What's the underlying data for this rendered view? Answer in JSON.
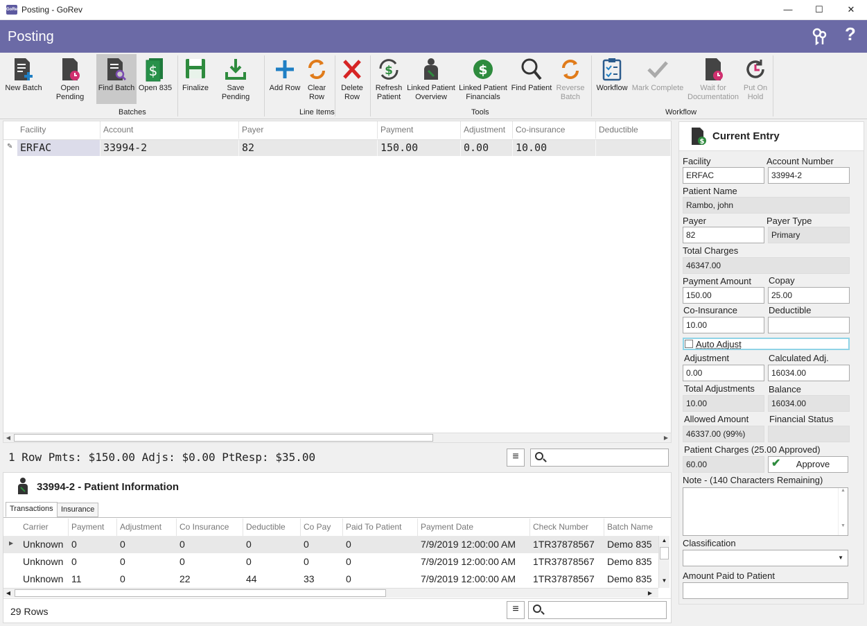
{
  "window": {
    "title": "Posting - GoRev",
    "min": "—",
    "max": "☐",
    "close": "✕",
    "app_icon": "GoRev"
  },
  "header": {
    "title": "Posting",
    "keys_icon": "keys-icon",
    "help": "?"
  },
  "ribbon": {
    "buttons": {
      "new_batch": "New Batch",
      "open_pending": "Open Pending",
      "find_batch": "Find Batch",
      "open_835": "Open 835",
      "finalize": "Finalize",
      "save_pending": "Save Pending",
      "add_row": "Add Row",
      "clear_row_1": "Clear",
      "clear_row_2": "Row",
      "delete_row_1": "Delete",
      "delete_row_2": "Row",
      "refresh_patient_1": "Refresh",
      "refresh_patient_2": "Patient",
      "linked_overview_1": "Linked Patient",
      "linked_overview_2": "Overview",
      "linked_financials_1": "Linked Patient",
      "linked_financials_2": "Financials",
      "find_patient": "Find Patient",
      "reverse_batch_1": "Reverse",
      "reverse_batch_2": "Batch",
      "workflow": "Workflow",
      "mark_complete": "Mark Complete",
      "wait_doc_1": "Wait for",
      "wait_doc_2": "Documentation",
      "put_on_hold_1": "Put On",
      "put_on_hold_2": "Hold"
    },
    "groups": {
      "batches": "Batches",
      "line_items": "Line Items",
      "tools": "Tools",
      "workflow": "Workflow"
    }
  },
  "grid": {
    "headers": {
      "facility": "Facility",
      "account": "Account",
      "payer": "Payer",
      "payment": "Payment",
      "adjustment": "Adjustment",
      "coins": "Co-insurance",
      "deductible": "Deductible"
    },
    "row": {
      "facility": "ERFAC",
      "account": "33994-2",
      "payer": "82",
      "payment": "150.00",
      "adjustment": "0.00",
      "coins": "10.00",
      "deductible": ""
    },
    "summary": "1 Row Pmts: $150.00 Adjs: $0.00 PtResp: $35.00"
  },
  "patient": {
    "title": "33994-2 - Patient Information",
    "tabs": {
      "transactions": "Transactions",
      "insurance": "Insurance"
    },
    "headers": {
      "carrier": "Carrier",
      "payment": "Payment",
      "adjustment": "Adjustment",
      "coins": "Co Insurance",
      "deductible": "Deductible",
      "copay": "Co Pay",
      "paid": "Paid To Patient",
      "date": "Payment Date",
      "check": "Check Number",
      "batch": "Batch Name"
    },
    "rows": [
      {
        "carrier": "Unknown",
        "payment": "0",
        "adjustment": "0",
        "coins": "0",
        "deductible": "0",
        "copay": "0",
        "paid": "0",
        "date": "7/9/2019 12:00:00 AM",
        "check": "1TR37878567",
        "batch": "Demo 835"
      },
      {
        "carrier": "Unknown",
        "payment": "0",
        "adjustment": "0",
        "coins": "0",
        "deductible": "0",
        "copay": "0",
        "paid": "0",
        "date": "7/9/2019 12:00:00 AM",
        "check": "1TR37878567",
        "batch": "Demo 835"
      },
      {
        "carrier": "Unknown",
        "payment": "11",
        "adjustment": "0",
        "coins": "22",
        "deductible": "44",
        "copay": "33",
        "paid": "0",
        "date": "7/9/2019 12:00:00 AM",
        "check": "1TR37878567",
        "batch": "Demo 835"
      }
    ],
    "row_count": "29 Rows"
  },
  "entry": {
    "title": "Current Entry",
    "labels": {
      "facility": "Facility",
      "account_number": "Account Number",
      "patient_name": "Patient Name",
      "payer": "Payer",
      "payer_type": "Payer Type",
      "total_charges": "Total Charges",
      "payment_amount": "Payment Amount",
      "copay": "Copay",
      "coins": "Co-Insurance",
      "deductible": "Deductible",
      "auto_adjust": "Auto Adjust",
      "adjustment": "Adjustment",
      "calc_adj": "Calculated Adj.",
      "total_adj": "Total Adjustments",
      "balance": "Balance",
      "allowed": "Allowed Amount",
      "fin_status": "Financial Status",
      "pat_charges": "Patient Charges (25.00 Approved)",
      "note": "Note - (140 Characters Remaining)",
      "classification": "Classification",
      "paid_to_patient": "Amount Paid to Patient"
    },
    "values": {
      "facility": "ERFAC",
      "account_number": "33994-2",
      "patient_name": "Rambo, john",
      "payer": "82",
      "payer_type": "Primary",
      "total_charges": "46347.00",
      "payment_amount": "150.00",
      "copay": "25.00",
      "coins": "10.00",
      "deductible": "",
      "adjustment": "0.00",
      "calc_adj": "16034.00",
      "total_adj": "10.00",
      "balance": "16034.00",
      "allowed": "46337.00 (99%)",
      "fin_status": "",
      "pat_charges": "60.00",
      "approve": "Approve"
    }
  }
}
